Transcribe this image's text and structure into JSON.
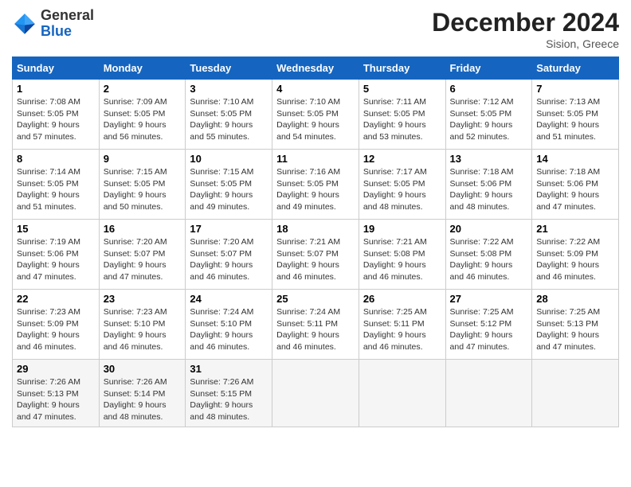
{
  "header": {
    "logo_general": "General",
    "logo_blue": "Blue",
    "month_title": "December 2024",
    "location": "Sision, Greece"
  },
  "days_of_week": [
    "Sunday",
    "Monday",
    "Tuesday",
    "Wednesday",
    "Thursday",
    "Friday",
    "Saturday"
  ],
  "weeks": [
    [
      {
        "day": "1",
        "sunrise": "Sunrise: 7:08 AM",
        "sunset": "Sunset: 5:05 PM",
        "daylight": "Daylight: 9 hours and 57 minutes."
      },
      {
        "day": "2",
        "sunrise": "Sunrise: 7:09 AM",
        "sunset": "Sunset: 5:05 PM",
        "daylight": "Daylight: 9 hours and 56 minutes."
      },
      {
        "day": "3",
        "sunrise": "Sunrise: 7:10 AM",
        "sunset": "Sunset: 5:05 PM",
        "daylight": "Daylight: 9 hours and 55 minutes."
      },
      {
        "day": "4",
        "sunrise": "Sunrise: 7:10 AM",
        "sunset": "Sunset: 5:05 PM",
        "daylight": "Daylight: 9 hours and 54 minutes."
      },
      {
        "day": "5",
        "sunrise": "Sunrise: 7:11 AM",
        "sunset": "Sunset: 5:05 PM",
        "daylight": "Daylight: 9 hours and 53 minutes."
      },
      {
        "day": "6",
        "sunrise": "Sunrise: 7:12 AM",
        "sunset": "Sunset: 5:05 PM",
        "daylight": "Daylight: 9 hours and 52 minutes."
      },
      {
        "day": "7",
        "sunrise": "Sunrise: 7:13 AM",
        "sunset": "Sunset: 5:05 PM",
        "daylight": "Daylight: 9 hours and 51 minutes."
      }
    ],
    [
      {
        "day": "8",
        "sunrise": "Sunrise: 7:14 AM",
        "sunset": "Sunset: 5:05 PM",
        "daylight": "Daylight: 9 hours and 51 minutes."
      },
      {
        "day": "9",
        "sunrise": "Sunrise: 7:15 AM",
        "sunset": "Sunset: 5:05 PM",
        "daylight": "Daylight: 9 hours and 50 minutes."
      },
      {
        "day": "10",
        "sunrise": "Sunrise: 7:15 AM",
        "sunset": "Sunset: 5:05 PM",
        "daylight": "Daylight: 9 hours and 49 minutes."
      },
      {
        "day": "11",
        "sunrise": "Sunrise: 7:16 AM",
        "sunset": "Sunset: 5:05 PM",
        "daylight": "Daylight: 9 hours and 49 minutes."
      },
      {
        "day": "12",
        "sunrise": "Sunrise: 7:17 AM",
        "sunset": "Sunset: 5:05 PM",
        "daylight": "Daylight: 9 hours and 48 minutes."
      },
      {
        "day": "13",
        "sunrise": "Sunrise: 7:18 AM",
        "sunset": "Sunset: 5:06 PM",
        "daylight": "Daylight: 9 hours and 48 minutes."
      },
      {
        "day": "14",
        "sunrise": "Sunrise: 7:18 AM",
        "sunset": "Sunset: 5:06 PM",
        "daylight": "Daylight: 9 hours and 47 minutes."
      }
    ],
    [
      {
        "day": "15",
        "sunrise": "Sunrise: 7:19 AM",
        "sunset": "Sunset: 5:06 PM",
        "daylight": "Daylight: 9 hours and 47 minutes."
      },
      {
        "day": "16",
        "sunrise": "Sunrise: 7:20 AM",
        "sunset": "Sunset: 5:07 PM",
        "daylight": "Daylight: 9 hours and 47 minutes."
      },
      {
        "day": "17",
        "sunrise": "Sunrise: 7:20 AM",
        "sunset": "Sunset: 5:07 PM",
        "daylight": "Daylight: 9 hours and 46 minutes."
      },
      {
        "day": "18",
        "sunrise": "Sunrise: 7:21 AM",
        "sunset": "Sunset: 5:07 PM",
        "daylight": "Daylight: 9 hours and 46 minutes."
      },
      {
        "day": "19",
        "sunrise": "Sunrise: 7:21 AM",
        "sunset": "Sunset: 5:08 PM",
        "daylight": "Daylight: 9 hours and 46 minutes."
      },
      {
        "day": "20",
        "sunrise": "Sunrise: 7:22 AM",
        "sunset": "Sunset: 5:08 PM",
        "daylight": "Daylight: 9 hours and 46 minutes."
      },
      {
        "day": "21",
        "sunrise": "Sunrise: 7:22 AM",
        "sunset": "Sunset: 5:09 PM",
        "daylight": "Daylight: 9 hours and 46 minutes."
      }
    ],
    [
      {
        "day": "22",
        "sunrise": "Sunrise: 7:23 AM",
        "sunset": "Sunset: 5:09 PM",
        "daylight": "Daylight: 9 hours and 46 minutes."
      },
      {
        "day": "23",
        "sunrise": "Sunrise: 7:23 AM",
        "sunset": "Sunset: 5:10 PM",
        "daylight": "Daylight: 9 hours and 46 minutes."
      },
      {
        "day": "24",
        "sunrise": "Sunrise: 7:24 AM",
        "sunset": "Sunset: 5:10 PM",
        "daylight": "Daylight: 9 hours and 46 minutes."
      },
      {
        "day": "25",
        "sunrise": "Sunrise: 7:24 AM",
        "sunset": "Sunset: 5:11 PM",
        "daylight": "Daylight: 9 hours and 46 minutes."
      },
      {
        "day": "26",
        "sunrise": "Sunrise: 7:25 AM",
        "sunset": "Sunset: 5:11 PM",
        "daylight": "Daylight: 9 hours and 46 minutes."
      },
      {
        "day": "27",
        "sunrise": "Sunrise: 7:25 AM",
        "sunset": "Sunset: 5:12 PM",
        "daylight": "Daylight: 9 hours and 47 minutes."
      },
      {
        "day": "28",
        "sunrise": "Sunrise: 7:25 AM",
        "sunset": "Sunset: 5:13 PM",
        "daylight": "Daylight: 9 hours and 47 minutes."
      }
    ],
    [
      {
        "day": "29",
        "sunrise": "Sunrise: 7:26 AM",
        "sunset": "Sunset: 5:13 PM",
        "daylight": "Daylight: 9 hours and 47 minutes."
      },
      {
        "day": "30",
        "sunrise": "Sunrise: 7:26 AM",
        "sunset": "Sunset: 5:14 PM",
        "daylight": "Daylight: 9 hours and 48 minutes."
      },
      {
        "day": "31",
        "sunrise": "Sunrise: 7:26 AM",
        "sunset": "Sunset: 5:15 PM",
        "daylight": "Daylight: 9 hours and 48 minutes."
      },
      null,
      null,
      null,
      null
    ]
  ]
}
